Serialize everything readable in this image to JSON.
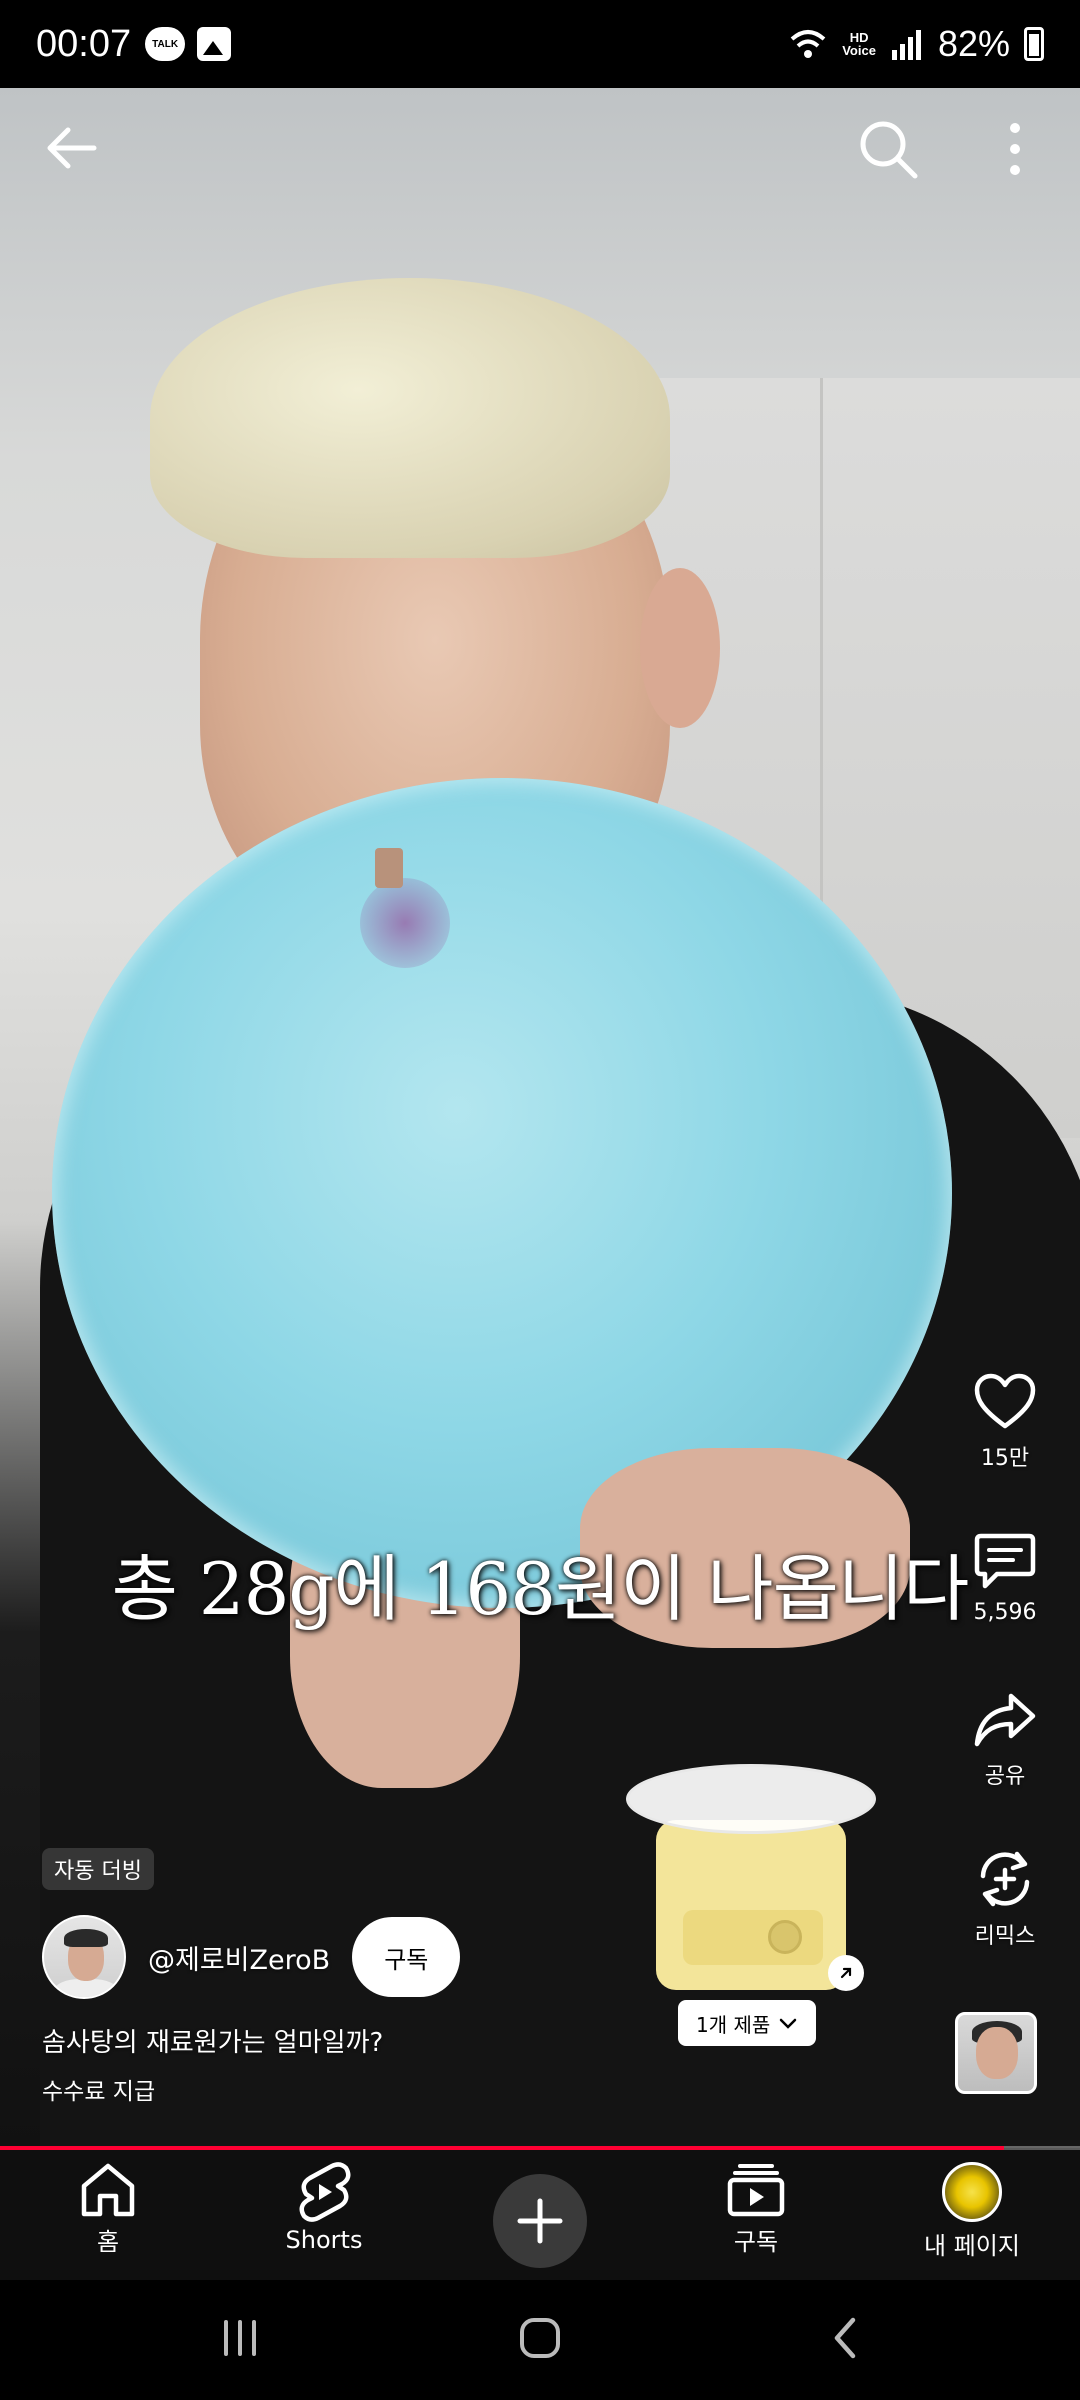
{
  "status_bar": {
    "time": "00:07",
    "talk_icon_text": "TALK",
    "hd_voice_line1": "HD",
    "hd_voice_line2": "Voice",
    "battery": "82%"
  },
  "video": {
    "caption": "총 28g에 168원이 나옵니다",
    "progress": 0.93
  },
  "actions": {
    "like_count": "15만",
    "comment_count": "5,596",
    "share_label": "공유",
    "remix_label": "리믹스"
  },
  "product": {
    "chip_label": "1개 제품"
  },
  "info": {
    "dub_badge": "자동 더빙",
    "channel_name": "@제로비ZeroB",
    "subscribe_label": "구독",
    "title": "솜사탕의 재료원가는 얼마일까?",
    "paid_promotion": "수수료 지급"
  },
  "bottom_nav": {
    "home": "홈",
    "shorts": "Shorts",
    "subscriptions": "구독",
    "you": "내 페이지"
  },
  "colors": {
    "accent": "#ff0033",
    "nav_bg": "#0f0f0f"
  }
}
